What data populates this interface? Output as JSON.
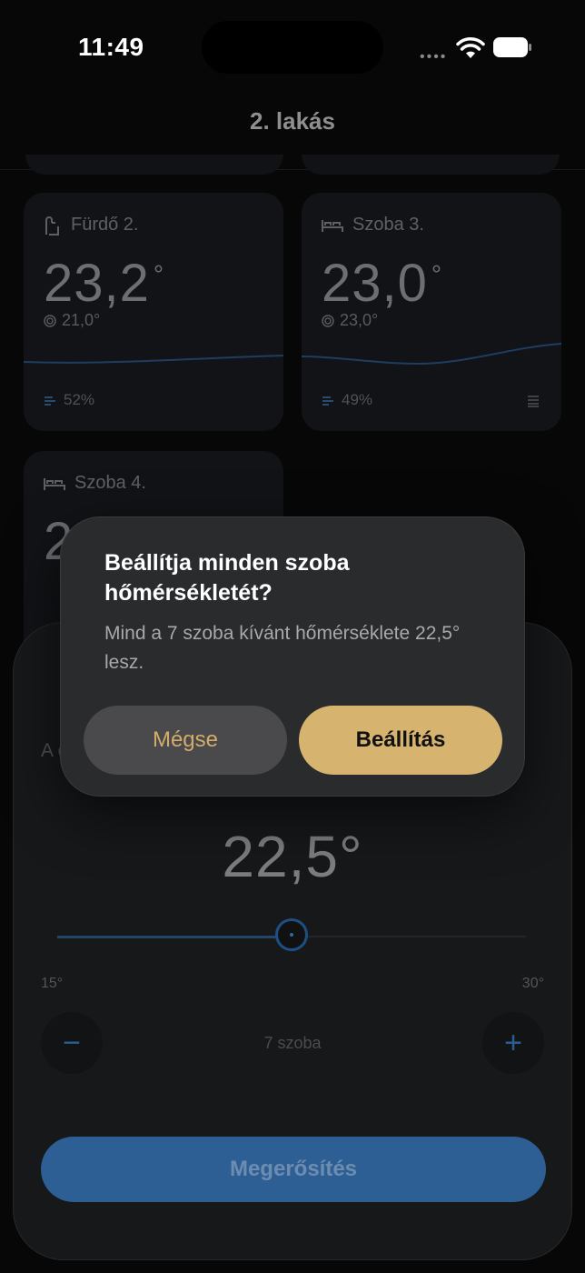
{
  "status_bar": {
    "time": "11:49",
    "signal_dots": "••••"
  },
  "header": {
    "title": "2. lakás"
  },
  "rooms": [
    {
      "name": "Fürdő 2.",
      "icon": "bathroom-icon",
      "temp": "23,2",
      "target": "21,0°",
      "humidity": "52%"
    },
    {
      "name": "Szoba 3.",
      "icon": "bed-icon",
      "temp": "23,0",
      "target": "23,0°",
      "humidity": "49%"
    },
    {
      "name": "Szoba 4.",
      "icon": "bed-icon",
      "temp": "23,1",
      "target": "",
      "humidity": ""
    }
  ],
  "sheet": {
    "description": "A cél",
    "value": "22,5°",
    "slider": {
      "min_label": "15°",
      "max_label": "30°",
      "min": 15,
      "max": 30,
      "value": 22.5
    },
    "minus_label": "−",
    "plus_label": "+",
    "room_count": "7 szoba",
    "confirm_label": "Megerősítés"
  },
  "dialog": {
    "title": "Beállítja minden szoba hőmérsékletét?",
    "message": "Mind a 7 szoba kívánt hőmérséklete 22,5° lesz.",
    "cancel_label": "Mégse",
    "confirm_label": "Beállítás"
  },
  "colors": {
    "accent_gold": "#d7b370",
    "accent_blue": "#2d5f95"
  }
}
